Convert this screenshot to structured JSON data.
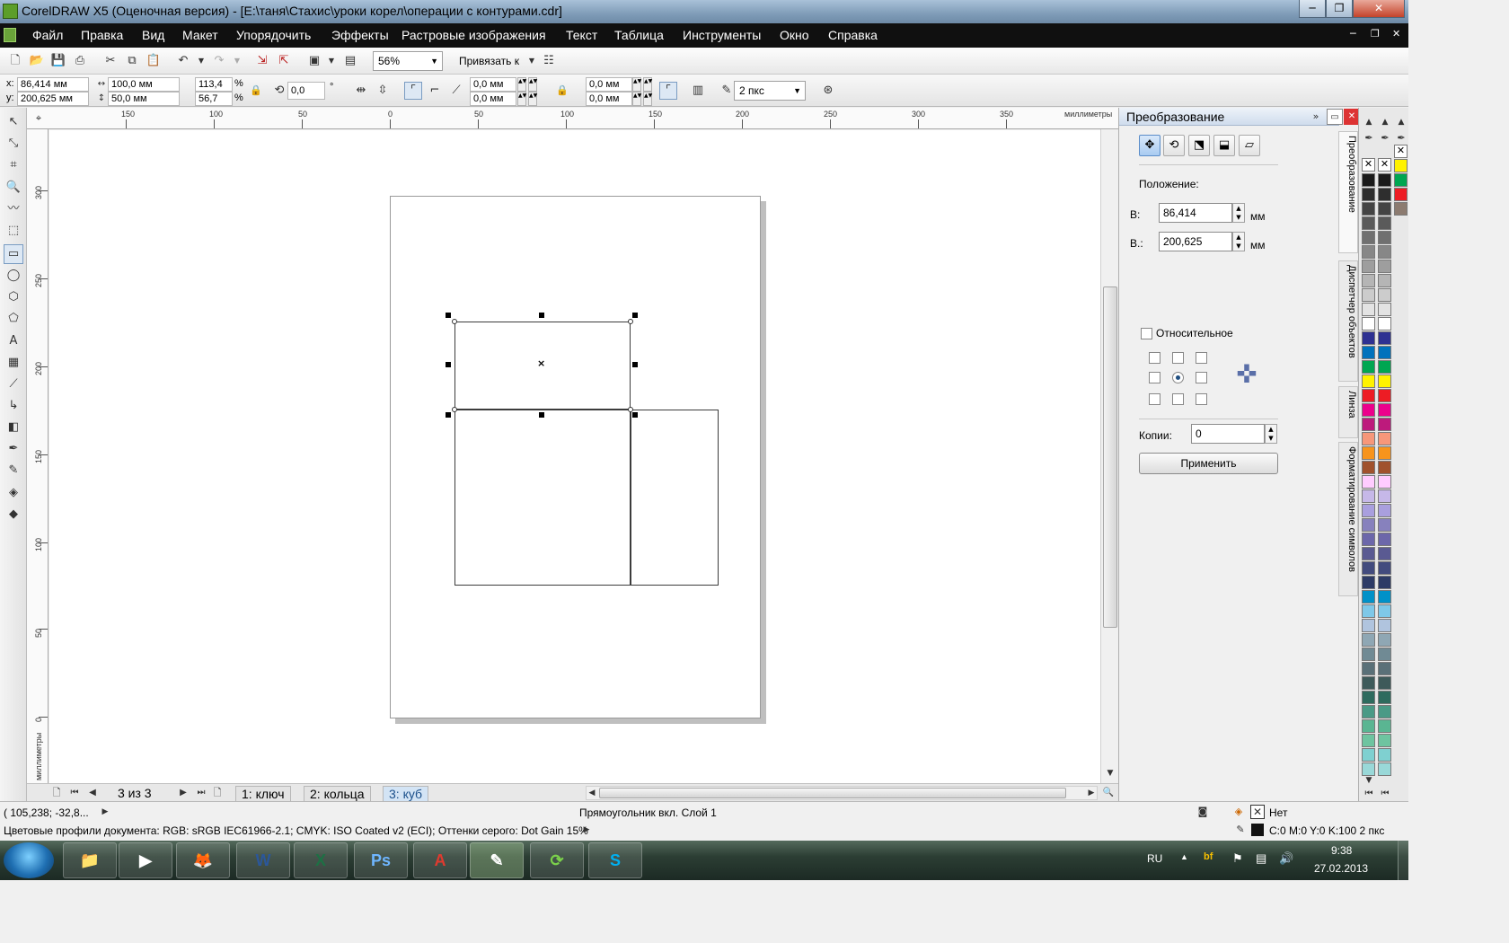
{
  "window": {
    "title": "CorelDRAW X5 (Оценочная версия) - [E:\\таня\\Стахис\\уроки корел\\операции с контурами.cdr]",
    "minimize": "─",
    "maximize": "❐",
    "close": "✕"
  },
  "menu": [
    "Файл",
    "Правка",
    "Вид",
    "Макет",
    "Упорядочить",
    "Эффекты",
    "Растровые изображения",
    "Текст",
    "Таблица",
    "Инструменты",
    "Окно",
    "Справка"
  ],
  "mdi": {
    "minimize": "─",
    "restore": "❐",
    "close": "✕"
  },
  "toolbar": {
    "zoom": "56%",
    "snap": "Привязать к"
  },
  "property_bar": {
    "x_label": "x:",
    "x": "86,414 мм",
    "y_label": "y:",
    "y": "200,625 мм",
    "width": "100,0 мм",
    "height": "50,0 мм",
    "scale_x": "113,4",
    "scale_y": "56,7",
    "percent": "%",
    "angle": "0,0",
    "degree": "°",
    "corner_tl": "0,0 мм",
    "corner_bl": "0,0 мм",
    "corner_tr": "0,0 мм",
    "corner_br": "0,0 мм",
    "outline_width": "2 пкс"
  },
  "ruler": {
    "unit": "миллиметры",
    "h_labels": [
      "150",
      "100",
      "50",
      "0",
      "50",
      "100",
      "150",
      "200",
      "250",
      "300",
      "350"
    ],
    "v_labels": [
      "300",
      "250",
      "200",
      "150",
      "100",
      "50",
      "0"
    ],
    "v_unit": "миллиметры"
  },
  "pages": {
    "counter": "3 из 3",
    "tabs": [
      "1: ключ",
      "2: кольца",
      "3: куб"
    ]
  },
  "docker": {
    "title": "Преобразование",
    "position_label": "Положение:",
    "h_label": "В:",
    "h_value": "86,414",
    "v_label": "В.:",
    "v_value": "200,625",
    "unit": "мм",
    "relative_label": "Относительное",
    "copies_label": "Копии:",
    "copies_value": "0",
    "apply": "Применить"
  },
  "docker_tabs": [
    "Преобразование",
    "Диспетчер объектов",
    "Линза",
    "Форматирование символов"
  ],
  "palette_colors": [
    "#1a1a1a",
    "#2e2e2e",
    "#444444",
    "#5a5a5a",
    "#707070",
    "#878787",
    "#9e9e9e",
    "#b5b5b5",
    "#cccccc",
    "#e3e3e3",
    "#ffffff",
    "#2e3192",
    "#0072bc",
    "#00a651",
    "#fff200",
    "#ed1c24",
    "#ec008c",
    "#bd1a7c",
    "#f7977a",
    "#f7941d",
    "#a0522d",
    "#ffccff",
    "#c6b8e8",
    "#a99fde",
    "#8781bd",
    "#6c67aa",
    "#5a5a92",
    "#424b7e",
    "#2d3b66",
    "#0091c8",
    "#7ec8e8",
    "#b0c4de",
    "#8fa7b4",
    "#708a94",
    "#5a7078",
    "#3e5a5a",
    "#2e6b5e",
    "#4a9a86",
    "#5ab592",
    "#6ec4a0",
    "#7fd0d0",
    "#99d8d8"
  ],
  "palette_colors_2": [
    "#fff200",
    "#00a651",
    "#ed1c24",
    "#8c7b70"
  ],
  "status": {
    "coords": "( 105,238; -32,8... ",
    "object": "Прямоугольник вкл. Слой 1",
    "profiles": "Цветовые профили документа: RGB: sRGB IEC61966-2.1; CMYK: ISO Coated v2 (ECI); Оттенки серого: Dot Gain 15%",
    "fill": "Нет",
    "outline": "C:0 M:0 Y:0 K:100  2 пкс"
  },
  "taskbar": {
    "lang": "RU",
    "time": "9:38",
    "date": "27.02.2013",
    "apps": [
      "📁",
      "▶",
      "🦊",
      "W",
      "X",
      "Ps",
      "A",
      "✎",
      "⟳",
      "S"
    ]
  }
}
